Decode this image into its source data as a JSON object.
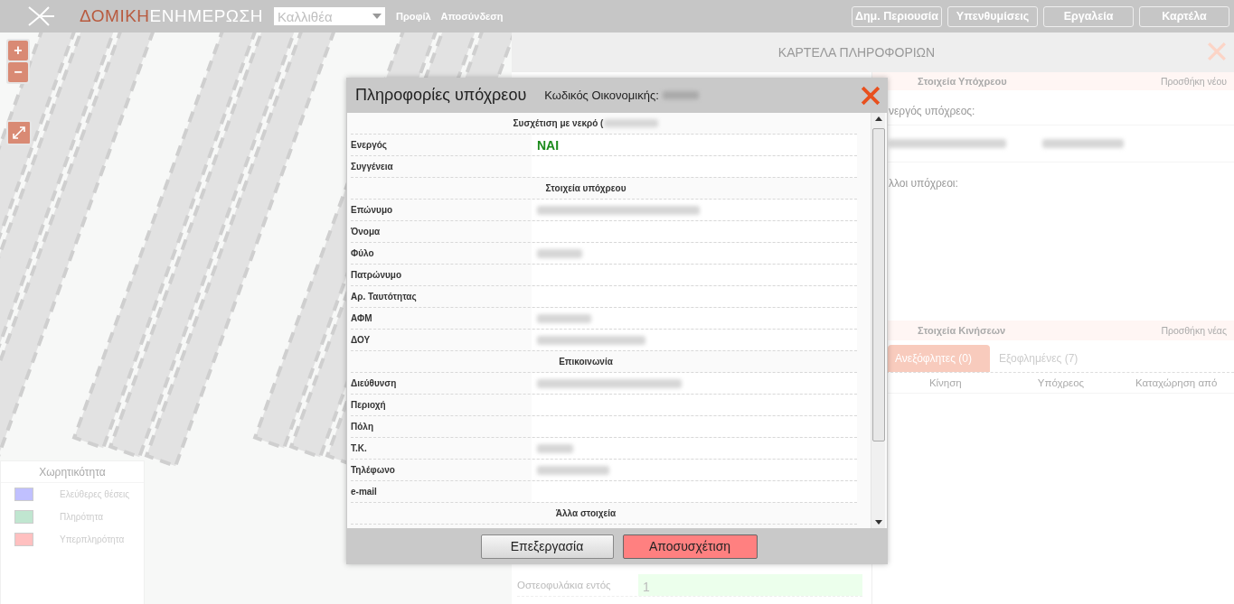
{
  "header": {
    "brand": {
      "first": "ΔΟΜΙΚΗ",
      "second": "ΕΝΗΜΕΡΩΣΗ"
    },
    "municipality_select": {
      "value": "Καλλιθέα"
    },
    "links": [
      "Προφίλ",
      "Αποσύνδεση"
    ],
    "buttons": [
      "Δημ. Περιουσία",
      "Υπενθυμίσεις",
      "Εργαλεία",
      "Καρτέλα"
    ]
  },
  "map": {
    "zoom_buttons": [
      "+",
      "−"
    ],
    "legend": {
      "title": "Χωρητικότητα",
      "items": [
        {
          "label": "Ελεύθερες θέσεις",
          "color": "#c0c0ff"
        },
        {
          "label": "Πληρότητα",
          "color": "#c0e6d0"
        },
        {
          "label": "Υπερπληρότητα",
          "color": "#ffc0c0"
        }
      ]
    }
  },
  "info_panel": {
    "title": "ΚΑΡΤΕΛΑ ΠΛΗΡΟΦΟΡΙΩΝ",
    "stats": [
      {
        "label": "Οστεοφυλάκια εντός",
        "value": "1",
        "color": "#ecffec"
      }
    ],
    "obligors": {
      "title": "Στοιχεία Υπόχρεου",
      "add_link": "Προσθήκη νέου",
      "active_label": "νεργός υπόχρεος:",
      "others_label": "λλοι υπόχρεοι:"
    },
    "movements": {
      "title": "Στοιχεία Κινήσεων",
      "add_link": "Προσθήκη νέας",
      "tabs": [
        {
          "label": "Ανεξόφλητες (0)",
          "selected": true
        },
        {
          "label": "Εξοφλημένες (7)",
          "selected": false
        }
      ],
      "columns": [
        "Κίνηση",
        "Υπόχρεος",
        "Καταχώρηση από"
      ]
    }
  },
  "modal": {
    "title": "Πληροφορίες υπόχρεου",
    "code_label": "Κωδικός Οικονομικής:",
    "rows": [
      {
        "kind": "section",
        "label": "Συσχέτιση με νεκρό (",
        "redacted": true
      },
      {
        "kind": "flag",
        "label": "Ενεργός",
        "value": "ΝΑΙ"
      },
      {
        "kind": "field",
        "label": "Συγγένεια"
      },
      {
        "kind": "section",
        "label": "Στοιχεία υπόχρεου"
      },
      {
        "kind": "field",
        "label": "Επώνυμο",
        "redacted": true
      },
      {
        "kind": "field",
        "label": "Όνομα"
      },
      {
        "kind": "field",
        "label": "Φύλο",
        "redacted": true
      },
      {
        "kind": "field",
        "label": "Πατρώνυμο"
      },
      {
        "kind": "field",
        "label": "Αρ. Ταυτότητας"
      },
      {
        "kind": "field",
        "label": "ΑΦΜ",
        "redacted": true
      },
      {
        "kind": "field",
        "label": "ΔΟΥ",
        "redacted": true
      },
      {
        "kind": "section",
        "label": "Επικοινωνία"
      },
      {
        "kind": "field",
        "label": "Διεύθυνση",
        "redacted": true
      },
      {
        "kind": "field",
        "label": "Περιοχή"
      },
      {
        "kind": "field",
        "label": "Πόλη"
      },
      {
        "kind": "field",
        "label": "Τ.Κ.",
        "redacted": true
      },
      {
        "kind": "field",
        "label": "Τηλέφωνο",
        "redacted": true
      },
      {
        "kind": "field",
        "label": "e-mail"
      },
      {
        "kind": "section",
        "label": "Άλλα στοιχεία"
      }
    ],
    "buttons": [
      {
        "label": "Επεξεργασία",
        "kind": "default"
      },
      {
        "label": "Αποσυσχέτιση",
        "kind": "danger"
      }
    ]
  }
}
